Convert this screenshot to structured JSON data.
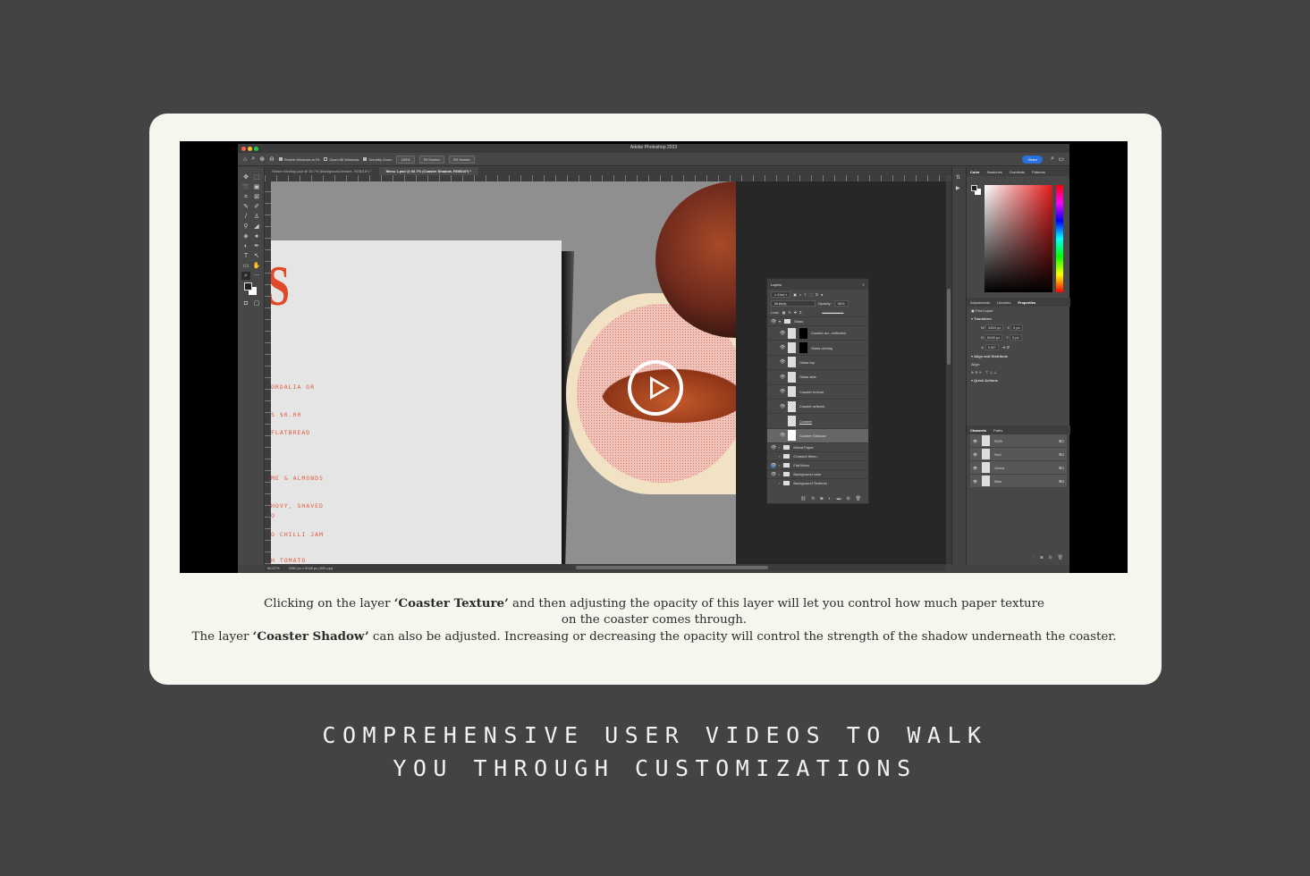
{
  "photoshop": {
    "window_title": "Adobe Photoshop 2023",
    "options_bar": {
      "resize_windows_to_fit": "Resize Windows to Fit",
      "zoom_all_windows": "Zoom All Windows",
      "scrubby_zoom": "Scrubby Zoom",
      "zoom_level_btn": "100%",
      "fit_screen": "Fit Screen",
      "fill_screen": "Fill Screen",
      "share": "Share"
    },
    "doc_tabs": [
      {
        "label": "Sticker Mockup.psd @ 16.7% (Background texture, RGB/16*) *",
        "active": false
      },
      {
        "label": "Menu 1.psd @ 66.7% (Coaster Shadow, RGB/16*) *",
        "active": true
      }
    ],
    "canvas": {
      "menu_big_letter": "S",
      "menu_lines": [
        "ORDALIA OR",
        "S $6.00",
        "FLATBREAD",
        "ME & ALMONDS",
        "HOVY, SHAVED",
        "O",
        "O CHILLI JAM",
        "H TOMATO"
      ]
    },
    "status": {
      "zoom": "66.67%",
      "doc_size": "3350 px x 5040 px (300 ppi)"
    },
    "layers_panel": {
      "tab": "Layers",
      "filter_kind": "Kind",
      "blend_mode": "Multiply",
      "opacity_label": "Opacity:",
      "opacity_value": "96%",
      "lock_label": "Lock:",
      "layers": [
        {
          "name": "Glass",
          "type": "group",
          "visible": true
        },
        {
          "name": "Coaster art...reflection",
          "type": "smart",
          "visible": true,
          "mask": true
        },
        {
          "name": "Glass overlay",
          "type": "pixel",
          "visible": true,
          "mask": true
        },
        {
          "name": "Glass top",
          "type": "pixel",
          "visible": true
        },
        {
          "name": "Glass side",
          "type": "pixel",
          "visible": true
        },
        {
          "name": "Coaster texture",
          "type": "pixel",
          "visible": true
        },
        {
          "name": "Coaster artwork",
          "type": "smart",
          "visible": true
        },
        {
          "name": "Coaster",
          "type": "pixel",
          "visible": false
        },
        {
          "name": "Coaster Shadow",
          "type": "pixel",
          "visible": true,
          "selected": true
        },
        {
          "name": "Mixed Paper",
          "type": "group",
          "visible": true
        },
        {
          "name": "Creased Menu",
          "type": "group",
          "visible": false
        },
        {
          "name": "Flat Menu",
          "type": "group",
          "visible": true,
          "highlight": true
        },
        {
          "name": "Background color",
          "type": "group",
          "visible": true
        },
        {
          "name": "Background Textures",
          "type": "group",
          "visible": false
        }
      ]
    },
    "color_panel": {
      "tabs": [
        "Color",
        "Swatches",
        "Gradients",
        "Patterns"
      ],
      "active_tab": "Color",
      "hue_color": "#e41b1b"
    },
    "properties_panel": {
      "tabs": [
        "Adjustments",
        "Libraries",
        "Properties"
      ],
      "active_tab": "Properties",
      "layer_type": "Pixel Layer",
      "transform_label": "Transform",
      "w": "3350 px",
      "h": "5040 px",
      "x": "0 px",
      "y": "0 px",
      "angle": "0.00°",
      "align_label": "Align and Distribute",
      "align_sub": "Align:",
      "quick_actions": "Quick Actions"
    },
    "channels_panel": {
      "tabs": [
        "Channels",
        "Paths"
      ],
      "active_tab": "Channels",
      "channels": [
        {
          "name": "RGB",
          "shortcut": "⌘2"
        },
        {
          "name": "Red",
          "shortcut": "⌘3"
        },
        {
          "name": "Green",
          "shortcut": "⌘4"
        },
        {
          "name": "Blue",
          "shortcut": "⌘5"
        }
      ]
    }
  },
  "video": {
    "play_icon": "play-icon"
  },
  "caption": {
    "line1_pre": "Clicking on the layer ",
    "line1_bold": "‘Coaster Texture’",
    "line1_post": " and then adjusting the opacity of this layer will let you control how much paper texture",
    "line2": "on the coaster comes through.",
    "line3_pre": "The layer ",
    "line3_bold": "‘Coaster Shadow’",
    "line3_post": " can also be adjusted. Increasing or decreasing the opacity will control the strength of the shadow underneath the coaster."
  },
  "headline": {
    "line1": "COMPREHENSIVE USER VIDEOS TO WALK",
    "line2": "YOU THROUGH CUSTOMIZATIONS"
  }
}
